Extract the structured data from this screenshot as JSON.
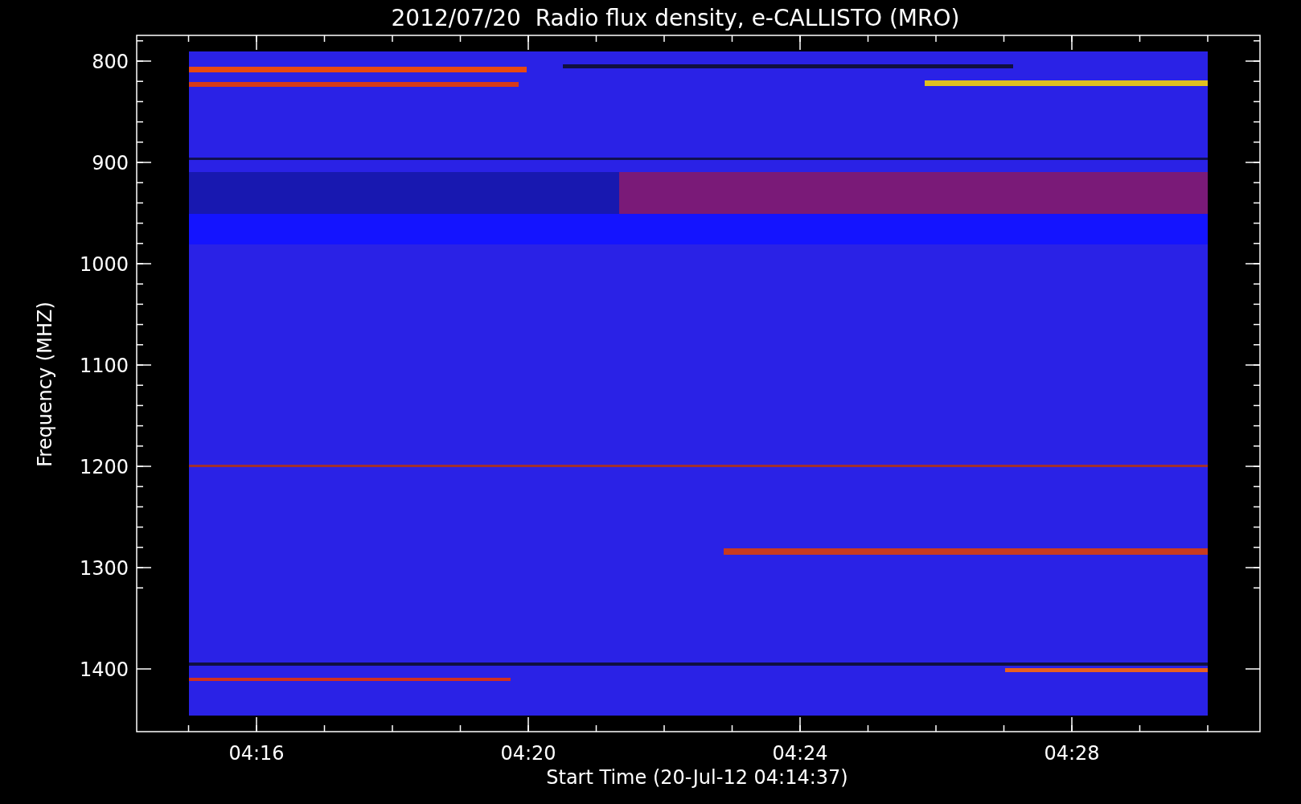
{
  "title": "2012/07/20  Radio flux density, e-CALLISTO (MRO)",
  "y_axis": {
    "label": "Frequency (MHZ)",
    "ticks": [
      "800",
      "900",
      "1000",
      "1100",
      "1200",
      "1300",
      "1400"
    ]
  },
  "x_axis": {
    "label": "Start Time (20-Jul-12 04:14:37)",
    "ticks": [
      "04:16",
      "04:20",
      "04:24",
      "04:28"
    ]
  }
}
